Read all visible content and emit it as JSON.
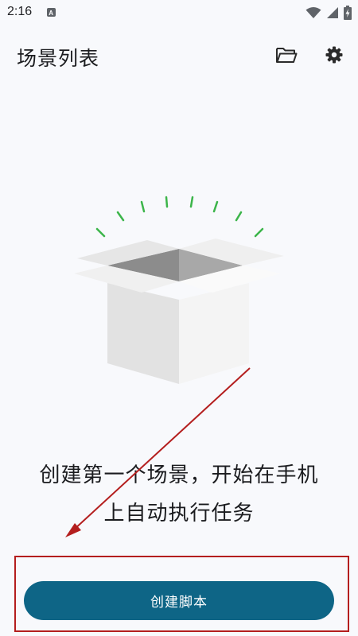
{
  "status_bar": {
    "time": "2:16",
    "icons": [
      "notification-a-icon",
      "wifi-icon",
      "signal-icon",
      "battery-charging-icon"
    ]
  },
  "header": {
    "title": "场景列表",
    "icons": [
      "folder-open-icon",
      "settings-gear-icon"
    ]
  },
  "empty_state": {
    "illustration": "open-box-illustration",
    "message_line1": "创建第一个场景，开始在手机",
    "message_line2": "上自动执行任务"
  },
  "primary_action": {
    "label": "创建脚本"
  },
  "annotations": {
    "highlight": "red-highlight-box",
    "arrow": "red-arrow-pointing-to-button"
  },
  "colors": {
    "background": "#f8f9fc",
    "button": "#0e6586",
    "sparkle": "#3cb54a",
    "annotation": "#b41e1e"
  }
}
